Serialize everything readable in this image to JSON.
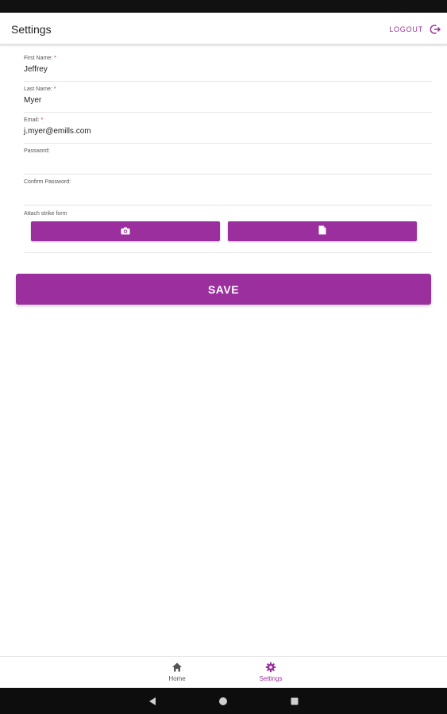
{
  "header": {
    "title": "Settings",
    "logout_label": "LOGOUT",
    "logout_icon": "logout-icon"
  },
  "form": {
    "first_name": {
      "label": "First Name:",
      "required_mark": "*",
      "value": "Jeffrey"
    },
    "last_name": {
      "label": "Last Name:",
      "required_mark": "*",
      "value": "Myer"
    },
    "email": {
      "label": "Email:",
      "required_mark": "*",
      "value": "j.myer@emills.com"
    },
    "password": {
      "label": "Password:",
      "value": ""
    },
    "confirm_password": {
      "label": "Confirm Password:",
      "value": ""
    },
    "attach": {
      "label": "Attach strike form",
      "camera_icon": "camera-icon",
      "file_icon": "file-icon"
    },
    "save_label": "SAVE"
  },
  "bottom_nav": {
    "items": [
      {
        "label": "Home",
        "icon": "home-icon",
        "active": false
      },
      {
        "label": "Settings",
        "icon": "gear-icon",
        "active": true
      }
    ]
  },
  "system_nav": [
    "back-icon",
    "home-circle-icon",
    "recents-icon"
  ],
  "colors": {
    "accent": "#9b2f9e",
    "required": "#d32f2f",
    "system_bar": "#111111"
  }
}
